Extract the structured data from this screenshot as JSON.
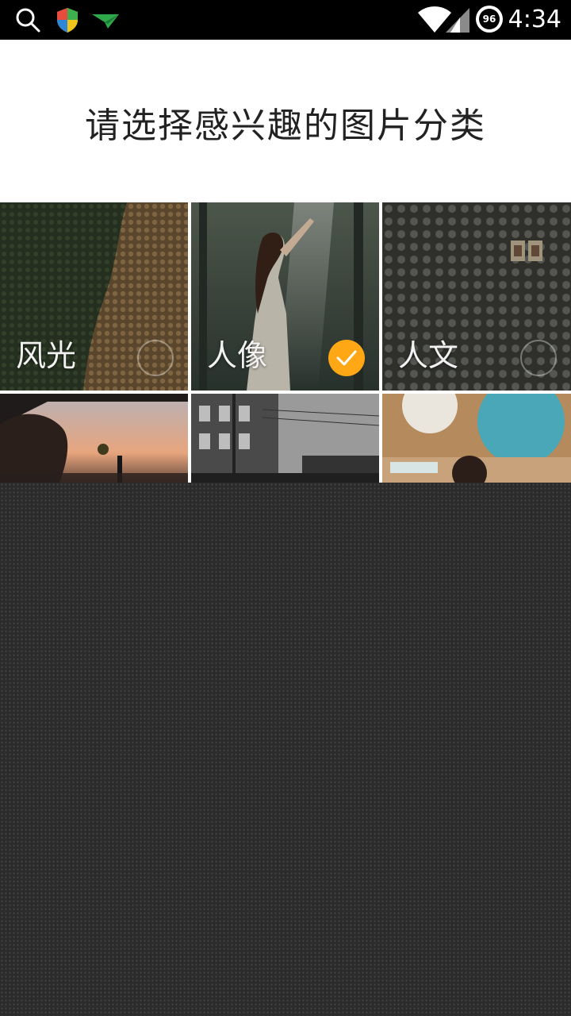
{
  "status_bar": {
    "time": "4:34",
    "battery_level": "96",
    "icons": [
      "search-icon",
      "shield-icon",
      "paper-plane-icon",
      "wifi-icon",
      "signal-icon"
    ]
  },
  "header": {
    "title": "请选择感兴趣的图片分类"
  },
  "categories": [
    {
      "label": "风光",
      "selected": false
    },
    {
      "label": "人像",
      "selected": true
    },
    {
      "label": "人文",
      "selected": false
    }
  ],
  "colors": {
    "accent": "#ffa714",
    "status_bar_bg": "#000000",
    "header_bg": "#ffffff",
    "overlay_bg": "#2b2b2b"
  }
}
